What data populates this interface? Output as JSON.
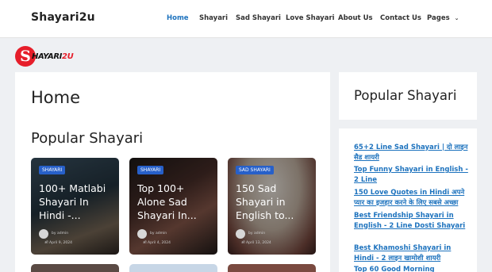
{
  "header": {
    "brand": "Shayari2u",
    "nav": [
      {
        "label": "Home",
        "active": true
      },
      {
        "label": "Shayari",
        "active": false
      },
      {
        "label": "Sad Shayari",
        "active": false
      },
      {
        "label": "Love Shayari",
        "active": false
      },
      {
        "label": "About Us",
        "active": false
      },
      {
        "label": "Contact Us",
        "active": false
      },
      {
        "label": "Pages",
        "active": false,
        "dropdown": true
      }
    ]
  },
  "logo": {
    "letter": "S",
    "text_dark": "HAYARI",
    "text_red": "2U"
  },
  "main": {
    "page_title": "Home",
    "section_title": "Popular Shayari",
    "cards": [
      {
        "tag": "Shayari",
        "title": "100+ Matlabi Shayari In Hindi -...",
        "author": "by admin",
        "date": "ऑ April 9, 2024"
      },
      {
        "tag": "Shayari",
        "title": "Top 100+ Alone Sad Shayari In...",
        "author": "by admin",
        "date": "ऑ April 4, 2024"
      },
      {
        "tag": "Sad Shayari",
        "title": "150 Sad Shayari in English to...",
        "author": "by admin",
        "date": "ऑ April 13, 2024"
      }
    ]
  },
  "sidebar": {
    "title": "Popular Shayari",
    "links": [
      "65+2 Line Sad Shayari | दो लाइन सैड शायरी",
      "Top Funny Shayari in English - 2 Line",
      "150 Love Quotes in Hindi अपने प्यार का इजहार करने के लिए सबसे अच्छा",
      "Best Friendship Shayari in English - 2 Line Dosti Shayari",
      "Best Khamoshi Shayari in Hindi - 2 लाइन खामोशी शायरी",
      "Top 60 Good Morning"
    ]
  },
  "colors": {
    "accent": "#1e73be",
    "tag": "#2760c9",
    "logo_red": "#e61e2a"
  }
}
